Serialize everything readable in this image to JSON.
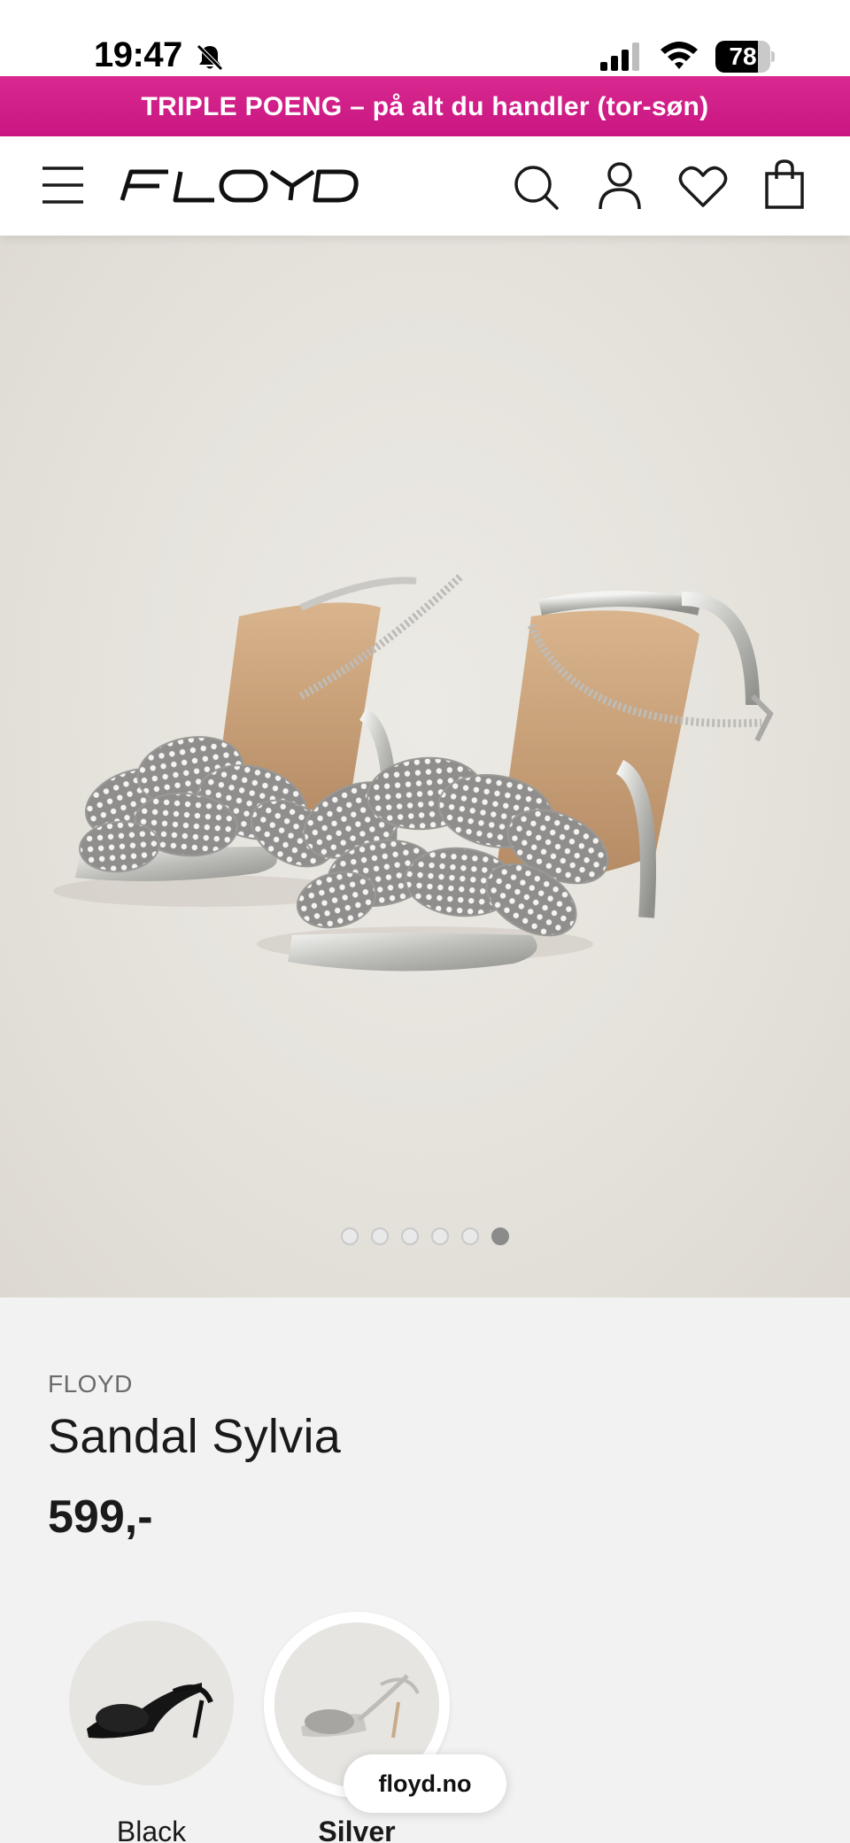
{
  "status_bar": {
    "time": "19:47",
    "battery": "78",
    "battery_level": 0.78
  },
  "promo": {
    "text": "TRIPLE POENG  –  på alt du handler (tor-søn)"
  },
  "header": {
    "logo": "FLOYD",
    "icons": [
      "menu-icon",
      "search-icon",
      "account-icon",
      "wishlist-icon",
      "bag-icon"
    ]
  },
  "gallery": {
    "image_count": 6,
    "active_index": 5
  },
  "product": {
    "brand": "FLOYD",
    "title": "Sandal Sylvia",
    "price": "599,-",
    "colors": [
      {
        "label": "Black",
        "selected": false
      },
      {
        "label": "Silver",
        "selected": true
      }
    ]
  },
  "browser": {
    "url": "floyd.no"
  },
  "colors": {
    "promo": "#d11f87",
    "info_bg": "#f2f2f2",
    "dot_active": "#8b8b8b"
  }
}
